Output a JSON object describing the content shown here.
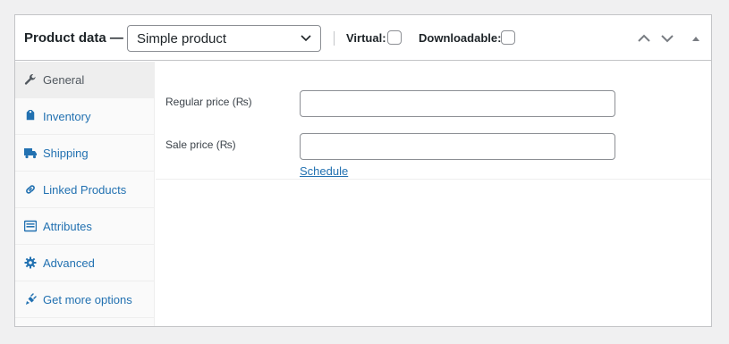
{
  "header": {
    "title": "Product data —",
    "product_type": "Simple product",
    "options": {
      "virtual_label": "Virtual:",
      "virtual_checked": false,
      "downloadable_label": "Downloadable:",
      "downloadable_checked": false
    },
    "controls": [
      {
        "icon": "chevron-up-icon"
      },
      {
        "icon": "chevron-down-icon"
      },
      {
        "icon": "triangle-up-icon"
      }
    ]
  },
  "sidebar": {
    "items": [
      {
        "label": "General",
        "icon": "wrench-icon",
        "active": true
      },
      {
        "label": "Inventory",
        "icon": "tag-icon",
        "active": false
      },
      {
        "label": "Shipping",
        "icon": "truck-icon",
        "active": false
      },
      {
        "label": "Linked Products",
        "icon": "link-icon",
        "active": false
      },
      {
        "label": "Attributes",
        "icon": "list-icon",
        "active": false
      },
      {
        "label": "Advanced",
        "icon": "gear-icon",
        "active": false
      },
      {
        "label": "Get more options",
        "icon": "plugin-icon",
        "active": false
      }
    ]
  },
  "general": {
    "regular_price_label": "Regular price (₨)",
    "regular_price_value": "",
    "sale_price_label": "Sale price (₨)",
    "sale_price_value": "",
    "schedule_link": "Schedule"
  },
  "colors": {
    "link": "#2271b1",
    "border": "#c3c4c7",
    "page_bg": "#f0f0f1"
  }
}
